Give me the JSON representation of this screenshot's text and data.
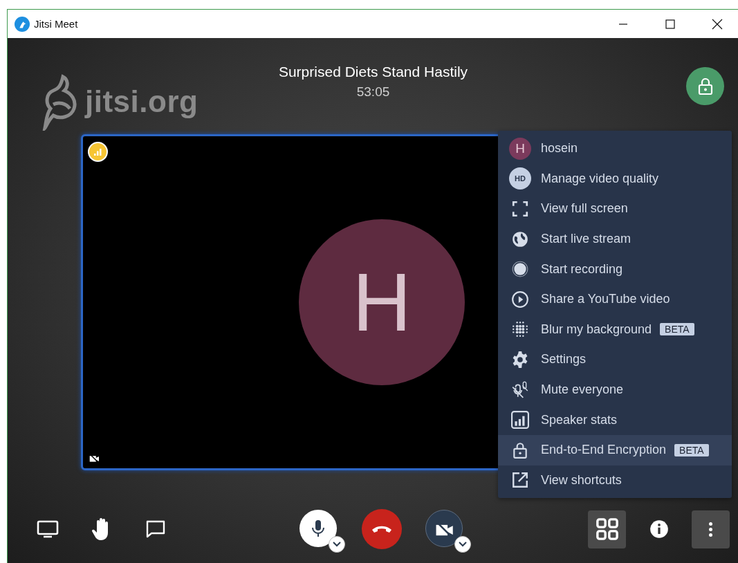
{
  "window": {
    "title": "Jitsi Meet"
  },
  "watermark": {
    "text": "jitsi.org"
  },
  "meeting": {
    "title": "Surprised Diets Stand Hastily",
    "duration": "53:05",
    "locked": true
  },
  "tile": {
    "avatar_letter": "H",
    "video_muted": true,
    "selected": true
  },
  "menu": {
    "items": [
      {
        "kind": "avatar",
        "icon_text": "H",
        "label": "hosein",
        "highlighted": false
      },
      {
        "kind": "badge-icon",
        "icon_text": "HD",
        "label": "Manage video quality",
        "highlighted": false
      },
      {
        "kind": "icon",
        "label": "View full screen",
        "highlighted": false
      },
      {
        "kind": "icon",
        "label": "Start live stream",
        "highlighted": false
      },
      {
        "kind": "icon",
        "label": "Start recording",
        "highlighted": false
      },
      {
        "kind": "icon",
        "label": "Share a YouTube video",
        "highlighted": false
      },
      {
        "kind": "icon",
        "label": "Blur my background",
        "badge": "BETA",
        "highlighted": false
      },
      {
        "kind": "icon",
        "label": "Settings",
        "highlighted": false
      },
      {
        "kind": "icon",
        "label": "Mute everyone",
        "highlighted": false
      },
      {
        "kind": "icon",
        "label": "Speaker stats",
        "highlighted": false
      },
      {
        "kind": "icon",
        "label": "End-to-End Encryption",
        "badge": "BETA",
        "highlighted": true
      },
      {
        "kind": "icon",
        "label": "View shortcuts",
        "highlighted": false
      }
    ]
  },
  "toolbar": {
    "audio_muted": false,
    "video_muted": true,
    "right_buttons": [
      {
        "kind": "tile-view",
        "selected": true
      },
      {
        "kind": "info",
        "selected": false
      },
      {
        "kind": "more",
        "selected": true
      }
    ]
  }
}
